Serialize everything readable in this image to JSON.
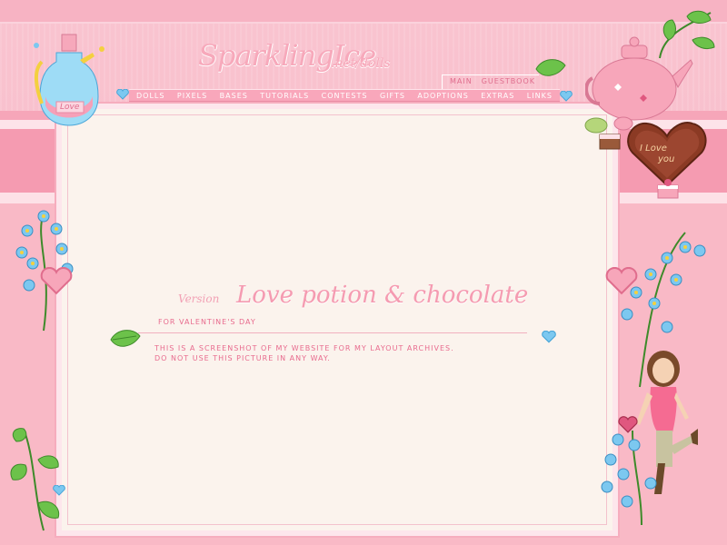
{
  "header": {
    "site_title": "SparklingIce",
    "site_suffix": ".net/dolls"
  },
  "top_links": [
    "Main",
    "Guestbook"
  ],
  "nav": {
    "items": [
      "Dolls",
      "Pixels",
      "Bases",
      "Tutorials",
      "Contests",
      "Gifts",
      "Adoptions",
      "Extras",
      "Links"
    ]
  },
  "content": {
    "version_label": "Version",
    "version_title": "Love potion & chocolate",
    "subtitle": "for valentine's day",
    "description_lines": [
      "This is a screenshot of my website for my layout archives.",
      "Do not use this picture in any way."
    ]
  },
  "decorations": {
    "potion_label": "Love",
    "chocolate_text_line1": "I Love",
    "chocolate_text_line2": "you"
  },
  "colors": {
    "background": "#f8b7c6",
    "content_bg": "#fbf3ed",
    "text_pink": "#e86b8e",
    "title_pink": "#f59bb1",
    "heart_blue": "#7cc8f0",
    "leaf_green": "#5fb83f"
  }
}
